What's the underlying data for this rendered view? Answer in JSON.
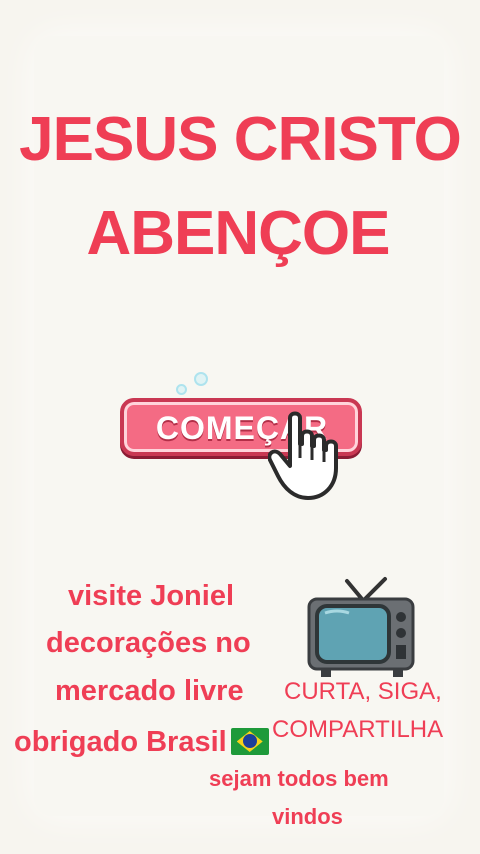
{
  "title": {
    "line1": "JESUS CRISTO",
    "line2": "ABENÇOE"
  },
  "start_button": {
    "label": "COMEÇAR",
    "icon": "pointing-hand-icon"
  },
  "promo": {
    "line1": "visite Joniel",
    "line2": "decorações no",
    "line3": "mercado livre",
    "line4": "obrigado Brasil",
    "flag_icon": "brazil-flag-icon"
  },
  "social": {
    "line1": "CURTA, SIGA,",
    "line2": "COMPARTILHA",
    "icon": "television-icon"
  },
  "welcome": {
    "line1": "sejam todos bem",
    "line2": "vindos"
  },
  "colors": {
    "accent": "#ef3e55",
    "background": "#f7f5ef",
    "button": "#f46b84"
  }
}
